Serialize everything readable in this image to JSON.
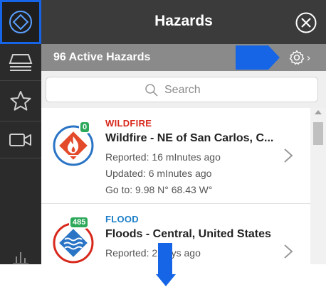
{
  "rail": {
    "items": [
      {
        "icon": "diamond-layers-icon",
        "active": true
      },
      {
        "icon": "layers-stack-icon"
      },
      {
        "icon": "star-icon"
      },
      {
        "icon": "video-camera-icon"
      },
      {
        "icon": "bar-chart-icon"
      }
    ]
  },
  "header": {
    "title": "Hazards",
    "close_icon": "close-circle-icon"
  },
  "subheader": {
    "count_label": "96 Active Hazards",
    "settings_icon": "gear-icon",
    "chevron": "›"
  },
  "search": {
    "placeholder": "Search"
  },
  "hazards": [
    {
      "category": "WILDFIRE",
      "badge": "0",
      "title": "Wildfire - NE of San Carlos, C...",
      "reported": "Reported: 16 mInutes ago",
      "updated": "Updated: 6 mInutes ago",
      "goto": "Go to: 9.98 N° 68.43 W°",
      "icon": "wildfire-icon",
      "color": "#d8281c"
    },
    {
      "category": "FLOOD",
      "badge": "485",
      "title": "Floods - Central, United States",
      "reported": "Reported: 2 days ago",
      "icon": "flood-icon",
      "color": "#1d7fc8"
    }
  ],
  "colors": {
    "accent": "#1565e6",
    "badge": "#2ba85a",
    "header": "#3b3b3b",
    "subheader": "#8a8a8a"
  }
}
